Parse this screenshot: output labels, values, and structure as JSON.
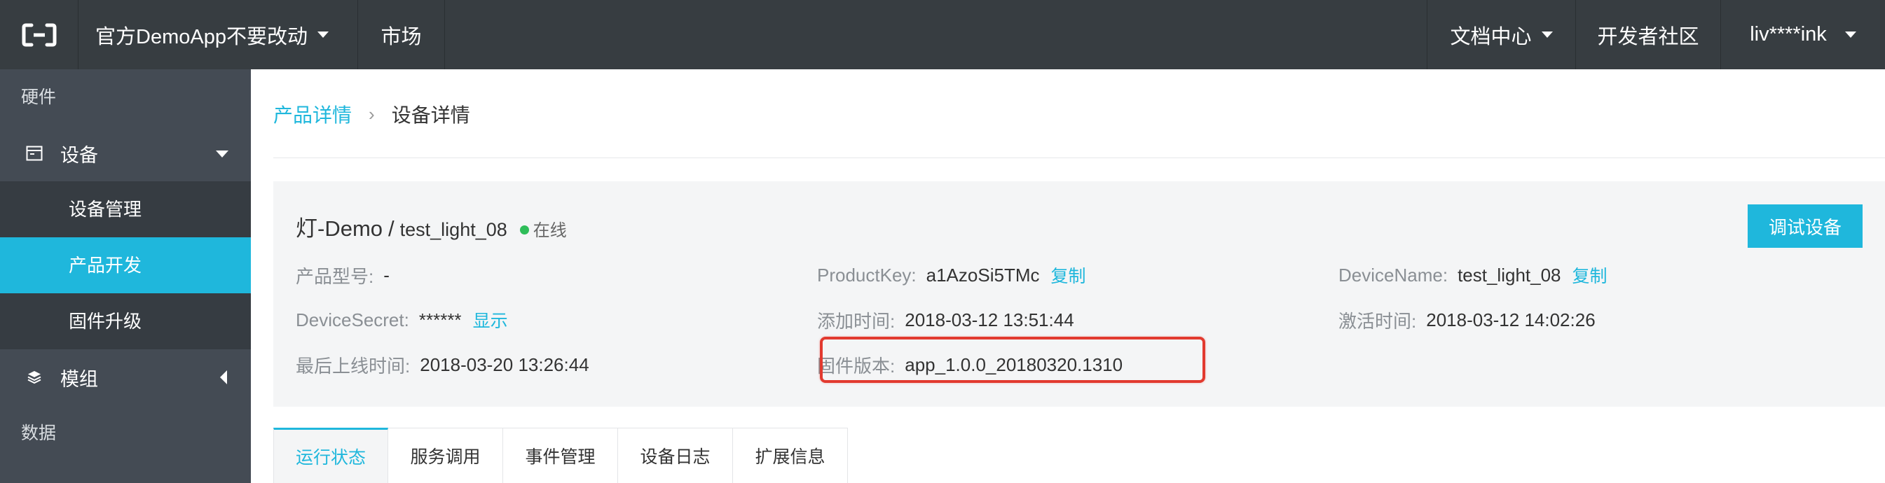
{
  "topbar": {
    "logo_icon": "aliyun-logo-icon",
    "app_selector": "官方DemoApp不要改动",
    "market": "市场",
    "docs": "文档中心",
    "community": "开发者社区",
    "user": "liv****ink"
  },
  "sidebar": {
    "section_hardware": "硬件",
    "device_group": "设备",
    "device_items": [
      "设备管理",
      "产品开发",
      "固件升级"
    ],
    "active_item": "产品开发",
    "module_group": "模组",
    "section_data": "数据"
  },
  "breadcrumb": {
    "parent": "产品详情",
    "separator": "›",
    "current": "设备详情"
  },
  "device": {
    "product_name": "灯-Demo",
    "separator": "/",
    "device_name": "test_light_08",
    "status": "在线",
    "status_color": "#2ebd59",
    "debug_button": "调试设备",
    "fields": {
      "model_label": "产品型号:",
      "model_value": "-",
      "productkey_label": "ProductKey:",
      "productkey_value": "a1AzoSi5TMc",
      "productkey_copy": "复制",
      "devicename_label": "DeviceName:",
      "devicename_value": "test_light_08",
      "devicename_copy": "复制",
      "secret_label": "DeviceSecret:",
      "secret_value": "******",
      "secret_show": "显示",
      "added_label": "添加时间:",
      "added_value": "2018-03-12 13:51:44",
      "activated_label": "激活时间:",
      "activated_value": "2018-03-12 14:02:26",
      "last_online_label": "最后上线时间:",
      "last_online_value": "2018-03-20 13:26:44",
      "firmware_label": "固件版本:",
      "firmware_value": "app_1.0.0_20180320.1310"
    }
  },
  "tabs": [
    "运行状态",
    "服务调用",
    "事件管理",
    "设备日志",
    "扩展信息"
  ],
  "active_tab": "运行状态",
  "colors": {
    "accent": "#1fb7dc",
    "topbar": "#373d41",
    "sidebar": "#444b54",
    "highlight": "#e23a2f"
  }
}
